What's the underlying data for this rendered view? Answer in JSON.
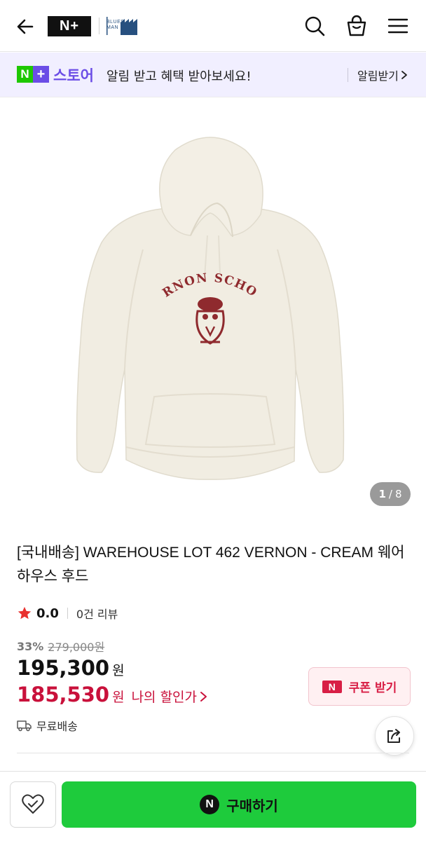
{
  "header": {
    "logo_text": "N+",
    "brand_logo_text": "BLUES MAN",
    "icons": [
      "back-arrow-icon",
      "search-icon",
      "shopping-bag-icon",
      "menu-icon"
    ]
  },
  "store_banner": {
    "badge_n": "N",
    "badge_plus": "+",
    "store_label": "스토어",
    "message": "알림 받고 혜택 받아보세요!",
    "link_label": "알림받기",
    "colors": {
      "background": "#f1efff",
      "purple": "#6b4de6",
      "green": "#1ec800"
    }
  },
  "gallery": {
    "image": "cream-hoodie-vernon-school",
    "print_text": "VERNON SCHOOL",
    "pager_current": "1",
    "pager_separator": "/",
    "pager_total": "8"
  },
  "product": {
    "title": "[국내배송] WAREHOUSE LOT 462 VERNON - CREAM 웨어하우스 후드",
    "rating": "0.0",
    "review_count": "0건 리뷰",
    "discount_rate": "33%",
    "original_price": "279,000원",
    "price": "195,300",
    "currency": "원",
    "my_price": "185,530",
    "my_price_label": "나의 할인가",
    "coupon_icon_text": "N",
    "coupon_label": "쿠폰 받기",
    "shipping": "무료배송",
    "colors": {
      "accent_red": "#c9113b",
      "star": "#e8312f"
    }
  },
  "bottom_bar": {
    "buy_icon_text": "N",
    "buy_label": "구매하기",
    "colors": {
      "buy_green": "#1ecb3c"
    }
  }
}
